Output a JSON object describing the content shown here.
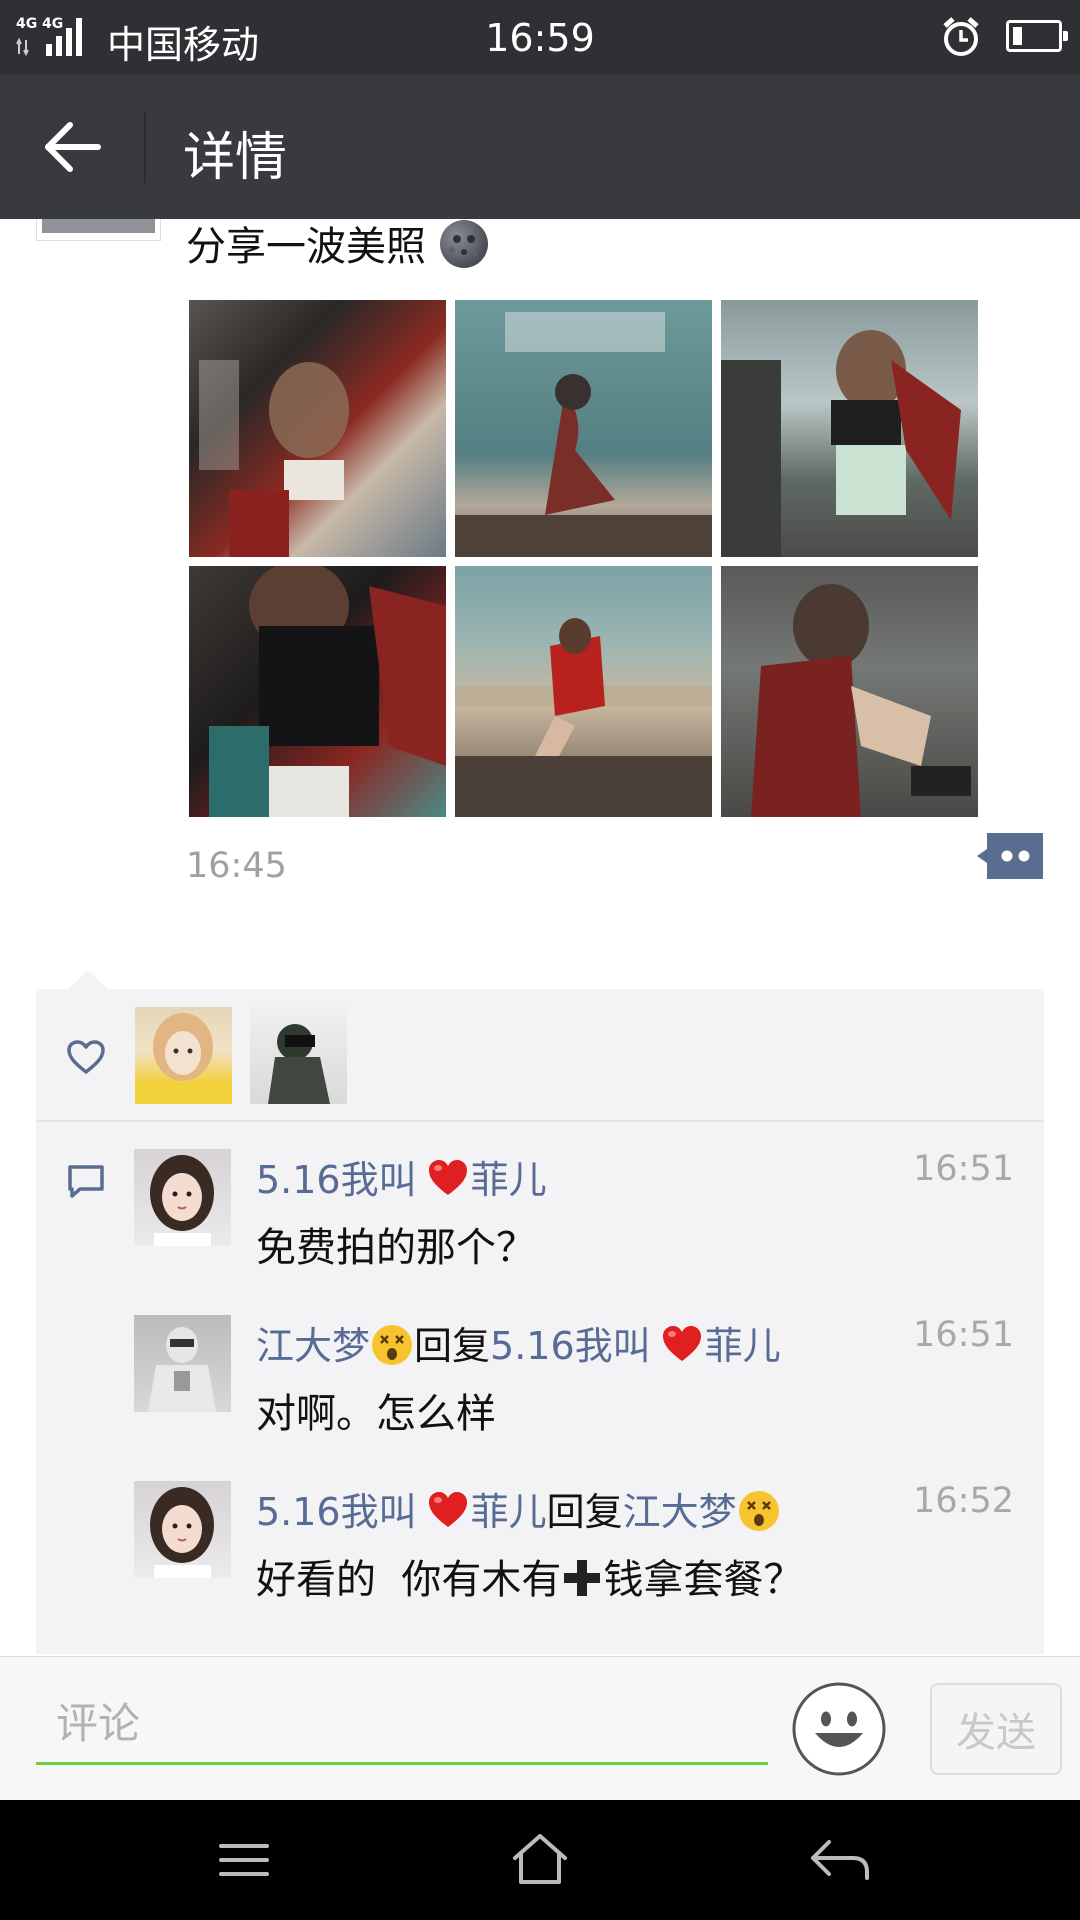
{
  "status_bar": {
    "network_1": "4G",
    "network_2": "4G",
    "carrier": "中国移动",
    "time": "16:59",
    "icons": [
      "signal-icon",
      "alarm-icon",
      "battery-icon"
    ]
  },
  "header": {
    "title": "详情",
    "back_icon": "arrow-left-icon"
  },
  "post": {
    "text": "分享一波美照",
    "emoji": "new-moon-face-emoji",
    "photo_count": 6,
    "time": "16:45",
    "comment_button_icon": "comment-dots-icon"
  },
  "likes": {
    "icon": "heart-outline-icon",
    "count": 2
  },
  "comments": [
    {
      "author": "5.16我叫",
      "author_suffix": "菲儿",
      "reply_label": "",
      "reply_to": "",
      "reply_to_suffix": "",
      "text": "免费拍的那个？",
      "time": "16:51"
    },
    {
      "author": "江大梦",
      "author_suffix": "",
      "reply_label": "回复",
      "reply_to": "5.16我叫",
      "reply_to_suffix": "菲儿",
      "text": "对啊。怎么样",
      "time": "16:51"
    },
    {
      "author": "5.16我叫",
      "author_suffix": "菲儿",
      "reply_label": "回复",
      "reply_to": "江大梦",
      "reply_to_suffix": "",
      "text_before": "好看的  你有木有",
      "text_after": "钱拿套餐？",
      "time": "16:52"
    }
  ],
  "input_bar": {
    "placeholder": "评论",
    "emoji_icon": "smiley-face-icon",
    "send_label": "发送"
  },
  "nav_bar": {
    "icons": [
      "menu-icon",
      "home-icon",
      "back-icon"
    ]
  },
  "colors": {
    "status_bar": "#2e3033",
    "title_bar": "#393a3f",
    "link_name": "#576b95",
    "comments_bg": "#f3f3f5",
    "input_underline": "#6fcf3a"
  }
}
